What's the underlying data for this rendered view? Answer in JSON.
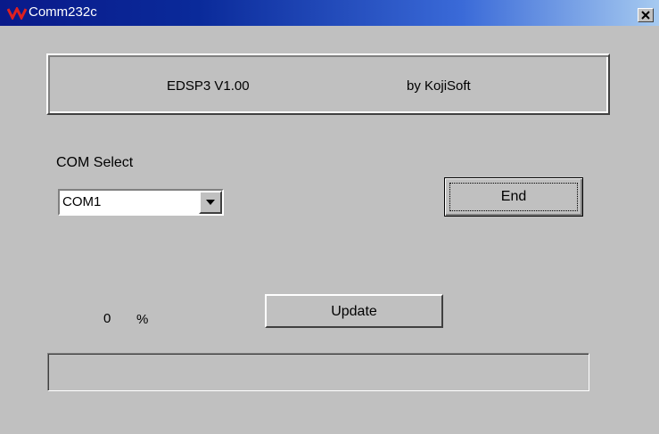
{
  "window": {
    "title": "Comm232c",
    "icon": "app-logo-icon",
    "close_icon": "close-icon"
  },
  "banner": {
    "product": "EDSP3   V1.00",
    "author": "by KojiSoft"
  },
  "com": {
    "label": "COM Select",
    "selected": "COM1",
    "arrow_icon": "chevron-down-icon"
  },
  "buttons": {
    "end": "End",
    "update": "Update"
  },
  "progress": {
    "value": "0",
    "unit": "%",
    "fraction": 0
  },
  "colors": {
    "face": "#c0c0c0",
    "title_start": "#0a1a8a",
    "title_end": "#a6caf0",
    "progress_fill": "#000080"
  }
}
